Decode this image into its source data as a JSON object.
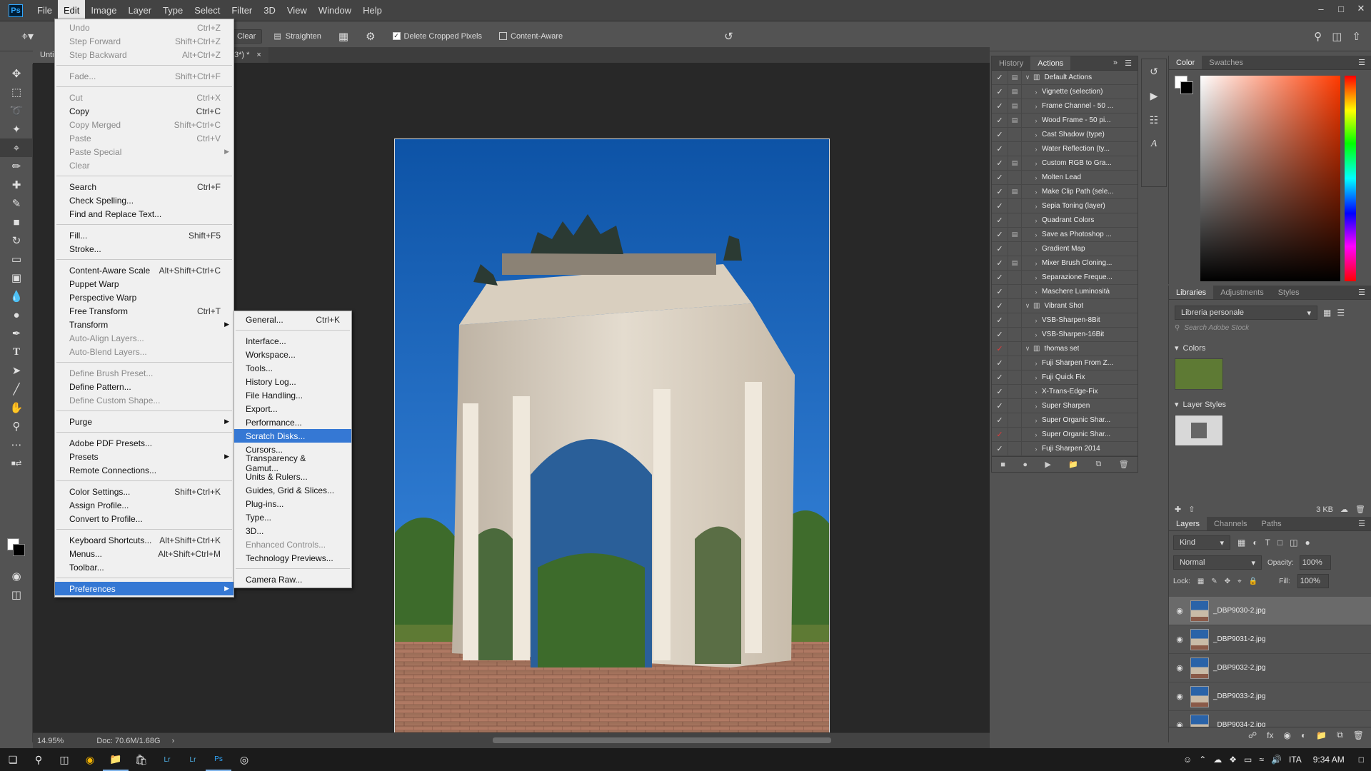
{
  "menubar": {
    "logo": "Ps",
    "items": [
      "File",
      "Edit",
      "Image",
      "Layer",
      "Type",
      "Select",
      "Filter",
      "3D",
      "View",
      "Window",
      "Help"
    ],
    "active": "Edit"
  },
  "options": {
    "clear": "Clear",
    "straighten": "Straighten",
    "delete_cropped": "Delete Cropped Pixels",
    "content_aware": "Content-Aware"
  },
  "doc": {
    "tab_left": "Unti",
    "tab_right": "3*) *"
  },
  "status": {
    "zoom": "14.95%",
    "doc": "Doc: 70.6M/1.68G"
  },
  "edit_menu": [
    {
      "label": "Undo",
      "shortcut": "Ctrl+Z",
      "disabled": true
    },
    {
      "label": "Step Forward",
      "shortcut": "Shift+Ctrl+Z",
      "disabled": true
    },
    {
      "label": "Step Backward",
      "shortcut": "Alt+Ctrl+Z",
      "disabled": true
    },
    {
      "sep": true
    },
    {
      "label": "Fade...",
      "shortcut": "Shift+Ctrl+F",
      "disabled": true
    },
    {
      "sep": true
    },
    {
      "label": "Cut",
      "shortcut": "Ctrl+X",
      "disabled": true
    },
    {
      "label": "Copy",
      "shortcut": "Ctrl+C"
    },
    {
      "label": "Copy Merged",
      "shortcut": "Shift+Ctrl+C",
      "disabled": true
    },
    {
      "label": "Paste",
      "shortcut": "Ctrl+V",
      "disabled": true
    },
    {
      "label": "Paste Special",
      "submenu": true,
      "disabled": true
    },
    {
      "label": "Clear",
      "disabled": true
    },
    {
      "sep": true
    },
    {
      "label": "Search",
      "shortcut": "Ctrl+F"
    },
    {
      "label": "Check Spelling..."
    },
    {
      "label": "Find and Replace Text..."
    },
    {
      "sep": true
    },
    {
      "label": "Fill...",
      "shortcut": "Shift+F5"
    },
    {
      "label": "Stroke..."
    },
    {
      "sep": true
    },
    {
      "label": "Content-Aware Scale",
      "shortcut": "Alt+Shift+Ctrl+C"
    },
    {
      "label": "Puppet Warp"
    },
    {
      "label": "Perspective Warp"
    },
    {
      "label": "Free Transform",
      "shortcut": "Ctrl+T"
    },
    {
      "label": "Transform",
      "submenu": true
    },
    {
      "label": "Auto-Align Layers...",
      "disabled": true
    },
    {
      "label": "Auto-Blend Layers...",
      "disabled": true
    },
    {
      "sep": true
    },
    {
      "label": "Define Brush Preset...",
      "disabled": true
    },
    {
      "label": "Define Pattern..."
    },
    {
      "label": "Define Custom Shape...",
      "disabled": true
    },
    {
      "sep": true
    },
    {
      "label": "Purge",
      "submenu": true
    },
    {
      "sep": true
    },
    {
      "label": "Adobe PDF Presets..."
    },
    {
      "label": "Presets",
      "submenu": true
    },
    {
      "label": "Remote Connections..."
    },
    {
      "sep": true
    },
    {
      "label": "Color Settings...",
      "shortcut": "Shift+Ctrl+K"
    },
    {
      "label": "Assign Profile..."
    },
    {
      "label": "Convert to Profile..."
    },
    {
      "sep": true
    },
    {
      "label": "Keyboard Shortcuts...",
      "shortcut": "Alt+Shift+Ctrl+K"
    },
    {
      "label": "Menus...",
      "shortcut": "Alt+Shift+Ctrl+M"
    },
    {
      "label": "Toolbar..."
    },
    {
      "sep": true
    },
    {
      "label": "Preferences",
      "submenu": true,
      "highlighted": true
    }
  ],
  "pref_menu": [
    {
      "label": "General...",
      "shortcut": "Ctrl+K"
    },
    {
      "sep": true
    },
    {
      "label": "Interface..."
    },
    {
      "label": "Workspace..."
    },
    {
      "label": "Tools..."
    },
    {
      "label": "History Log..."
    },
    {
      "label": "File Handling..."
    },
    {
      "label": "Export..."
    },
    {
      "label": "Performance..."
    },
    {
      "label": "Scratch Disks...",
      "highlighted": true
    },
    {
      "label": "Cursors..."
    },
    {
      "label": "Transparency & Gamut..."
    },
    {
      "label": "Units & Rulers..."
    },
    {
      "label": "Guides, Grid & Slices..."
    },
    {
      "label": "Plug-ins..."
    },
    {
      "label": "Type..."
    },
    {
      "label": "3D..."
    },
    {
      "label": "Enhanced Controls...",
      "disabled": true
    },
    {
      "label": "Technology Previews..."
    },
    {
      "sep": true
    },
    {
      "label": "Camera Raw..."
    }
  ],
  "history_panel": {
    "tabs": [
      "History",
      "Actions"
    ],
    "active_tab": "Actions",
    "actions": [
      {
        "name": "Default Actions",
        "folder": true,
        "open": true,
        "box": true
      },
      {
        "name": "Vignette (selection)",
        "box": true
      },
      {
        "name": "Frame Channel - 50 ...",
        "box": true
      },
      {
        "name": "Wood Frame - 50 pi...",
        "box": true
      },
      {
        "name": "Cast Shadow (type)"
      },
      {
        "name": "Water Reflection (ty..."
      },
      {
        "name": "Custom RGB to Gra...",
        "box": true
      },
      {
        "name": "Molten Lead"
      },
      {
        "name": "Make Clip Path (sele...",
        "box": true
      },
      {
        "name": "Sepia Toning (layer)"
      },
      {
        "name": "Quadrant Colors"
      },
      {
        "name": "Save as Photoshop ...",
        "box": true
      },
      {
        "name": "Gradient Map"
      },
      {
        "name": "Mixer Brush Cloning...",
        "box": true
      },
      {
        "name": "Separazione Freque..."
      },
      {
        "name": "Maschere Luminosità"
      },
      {
        "name": "Vibrant Shot",
        "folder": true,
        "open": true
      },
      {
        "name": "VSB-Sharpen-8Bit"
      },
      {
        "name": "VSB-Sharpen-16Bit"
      },
      {
        "name": "thomas set",
        "folder": true,
        "open": true,
        "red": true
      },
      {
        "name": "Fuji Sharpen From Z..."
      },
      {
        "name": "Fuji Quick Fix"
      },
      {
        "name": "X-Trans-Edge-Fix"
      },
      {
        "name": "Super Sharpen"
      },
      {
        "name": "Super Organic Shar..."
      },
      {
        "name": "Super Organic Shar...",
        "red": true
      },
      {
        "name": "Fuji Sharpen 2014"
      }
    ]
  },
  "color_panel": {
    "tabs": [
      "Color",
      "Swatches"
    ],
    "active_tab": "Color"
  },
  "libraries": {
    "tabs": [
      "Libraries",
      "Adjustments",
      "Styles"
    ],
    "active_tab": "Libraries",
    "library_name": "Libreria personale",
    "search_placeholder": "Search Adobe Stock",
    "colors_label": "Colors",
    "color_swatch": "#5e7a34",
    "layer_styles_label": "Layer Styles",
    "size": "3 KB"
  },
  "layers": {
    "tabs": [
      "Layers",
      "Channels",
      "Paths"
    ],
    "active_tab": "Layers",
    "filter": "Kind",
    "blend_mode": "Normal",
    "opacity_label": "Opacity:",
    "opacity": "100%",
    "lock_label": "Lock:",
    "fill_label": "Fill:",
    "fill": "100%",
    "items": [
      {
        "name": "_DBP9030-2.jpg",
        "selected": true
      },
      {
        "name": "_DBP9031-2.jpg"
      },
      {
        "name": "_DBP9032-2.jpg"
      },
      {
        "name": "_DBP9033-2.jpg"
      },
      {
        "name": "_DBP9034-2.jpg"
      }
    ]
  },
  "taskbar": {
    "language": "ITA",
    "time": "9:34 AM"
  }
}
